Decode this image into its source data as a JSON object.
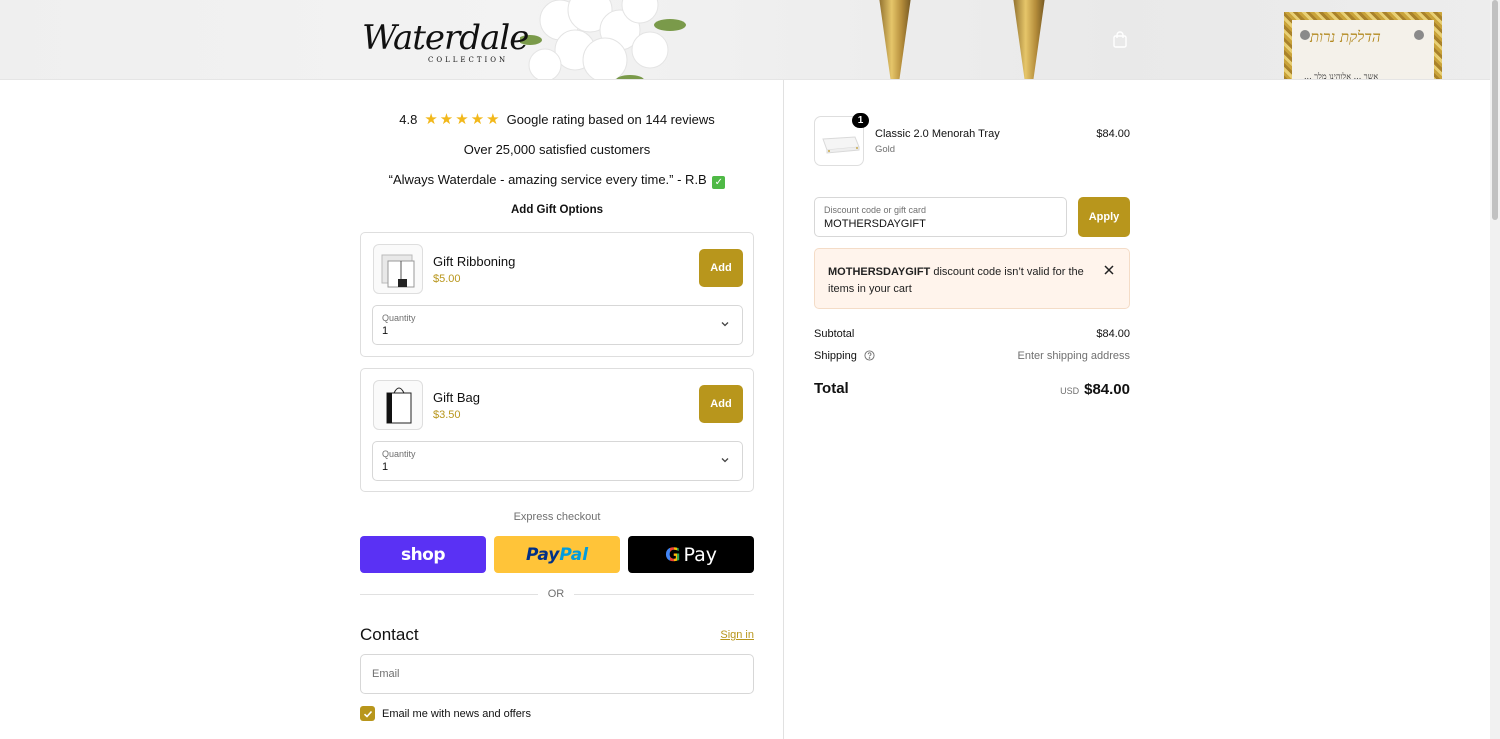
{
  "header": {
    "logo_script": "Waterdale",
    "logo_sub": "COLLECTION",
    "frame_text": "הדלקת נרות",
    "frame_subtext": "... אשר ... אלוהינו מלך"
  },
  "social_proof": {
    "rating_value": "4.8",
    "rating_text": "Google rating based on 144 reviews",
    "customers": "Over 25,000 satisfied customers",
    "quote": "“Always Waterdale - amazing service every time.” - R.B",
    "star_count": 5
  },
  "gift_options": {
    "title": "Add Gift Options",
    "items": [
      {
        "name": "Gift Ribboning",
        "price": "$5.00",
        "add_label": "Add",
        "qty_label": "Quantity",
        "qty_value": "1"
      },
      {
        "name": "Gift Bag",
        "price": "$3.50",
        "add_label": "Add",
        "qty_label": "Quantity",
        "qty_value": "1"
      }
    ]
  },
  "express_checkout": {
    "title": "Express checkout",
    "shop_label": "shop",
    "paypal_label_1": "Pay",
    "paypal_label_2": "Pal",
    "gpay_g": "G",
    "gpay_label": "Pay",
    "or_label": "OR"
  },
  "contact": {
    "title": "Contact",
    "signin_label": "Sign in",
    "email_placeholder": "Email",
    "optin_label": "Email me with news and offers",
    "optin_checked": true
  },
  "order_summary": {
    "product": {
      "name": "Classic 2.0 Menorah Tray",
      "variant": "Gold",
      "price": "$84.00",
      "quantity": "1"
    },
    "discount": {
      "label": "Discount code or gift card",
      "value": "MOTHERSDAYGIFT",
      "apply_label": "Apply"
    },
    "error": {
      "code": "MOTHERSDAYGIFT",
      "message": " discount code isn’t valid for the items in your cart"
    },
    "subtotal_label": "Subtotal",
    "subtotal_value": "$84.00",
    "shipping_label": "Shipping",
    "shipping_value": "Enter shipping address",
    "total_label": "Total",
    "total_currency": "USD",
    "total_value": "$84.00"
  },
  "colors": {
    "accent": "#b8961c",
    "shop_purple": "#5a31f4",
    "paypal_yellow": "#ffc439",
    "alert_bg": "#fff4ec"
  },
  "icons": [
    "shopping-bag-icon",
    "star-icon",
    "check-emoji-icon",
    "chevron-down-icon",
    "help-circle-icon",
    "close-icon",
    "checkbox-check-icon"
  ]
}
